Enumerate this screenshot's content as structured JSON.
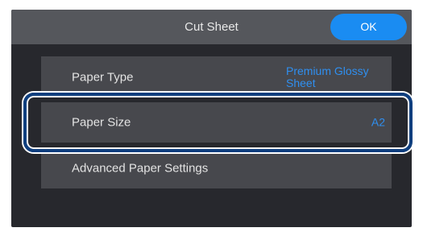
{
  "header": {
    "title": "Cut Sheet",
    "ok_label": "OK"
  },
  "settings": {
    "rows": [
      {
        "label": "Paper Type",
        "value": "Premium Glossy Sheet"
      },
      {
        "label": "Paper Size",
        "value": "A2"
      },
      {
        "label": "Advanced Paper Settings",
        "value": ""
      }
    ]
  },
  "colors": {
    "accent": "#1a8cf2",
    "value_text": "#2f8ff0",
    "highlight_border": "#0f3f7f",
    "background": "#27282d",
    "header_background": "#55575c",
    "row_background": "#47484d"
  }
}
